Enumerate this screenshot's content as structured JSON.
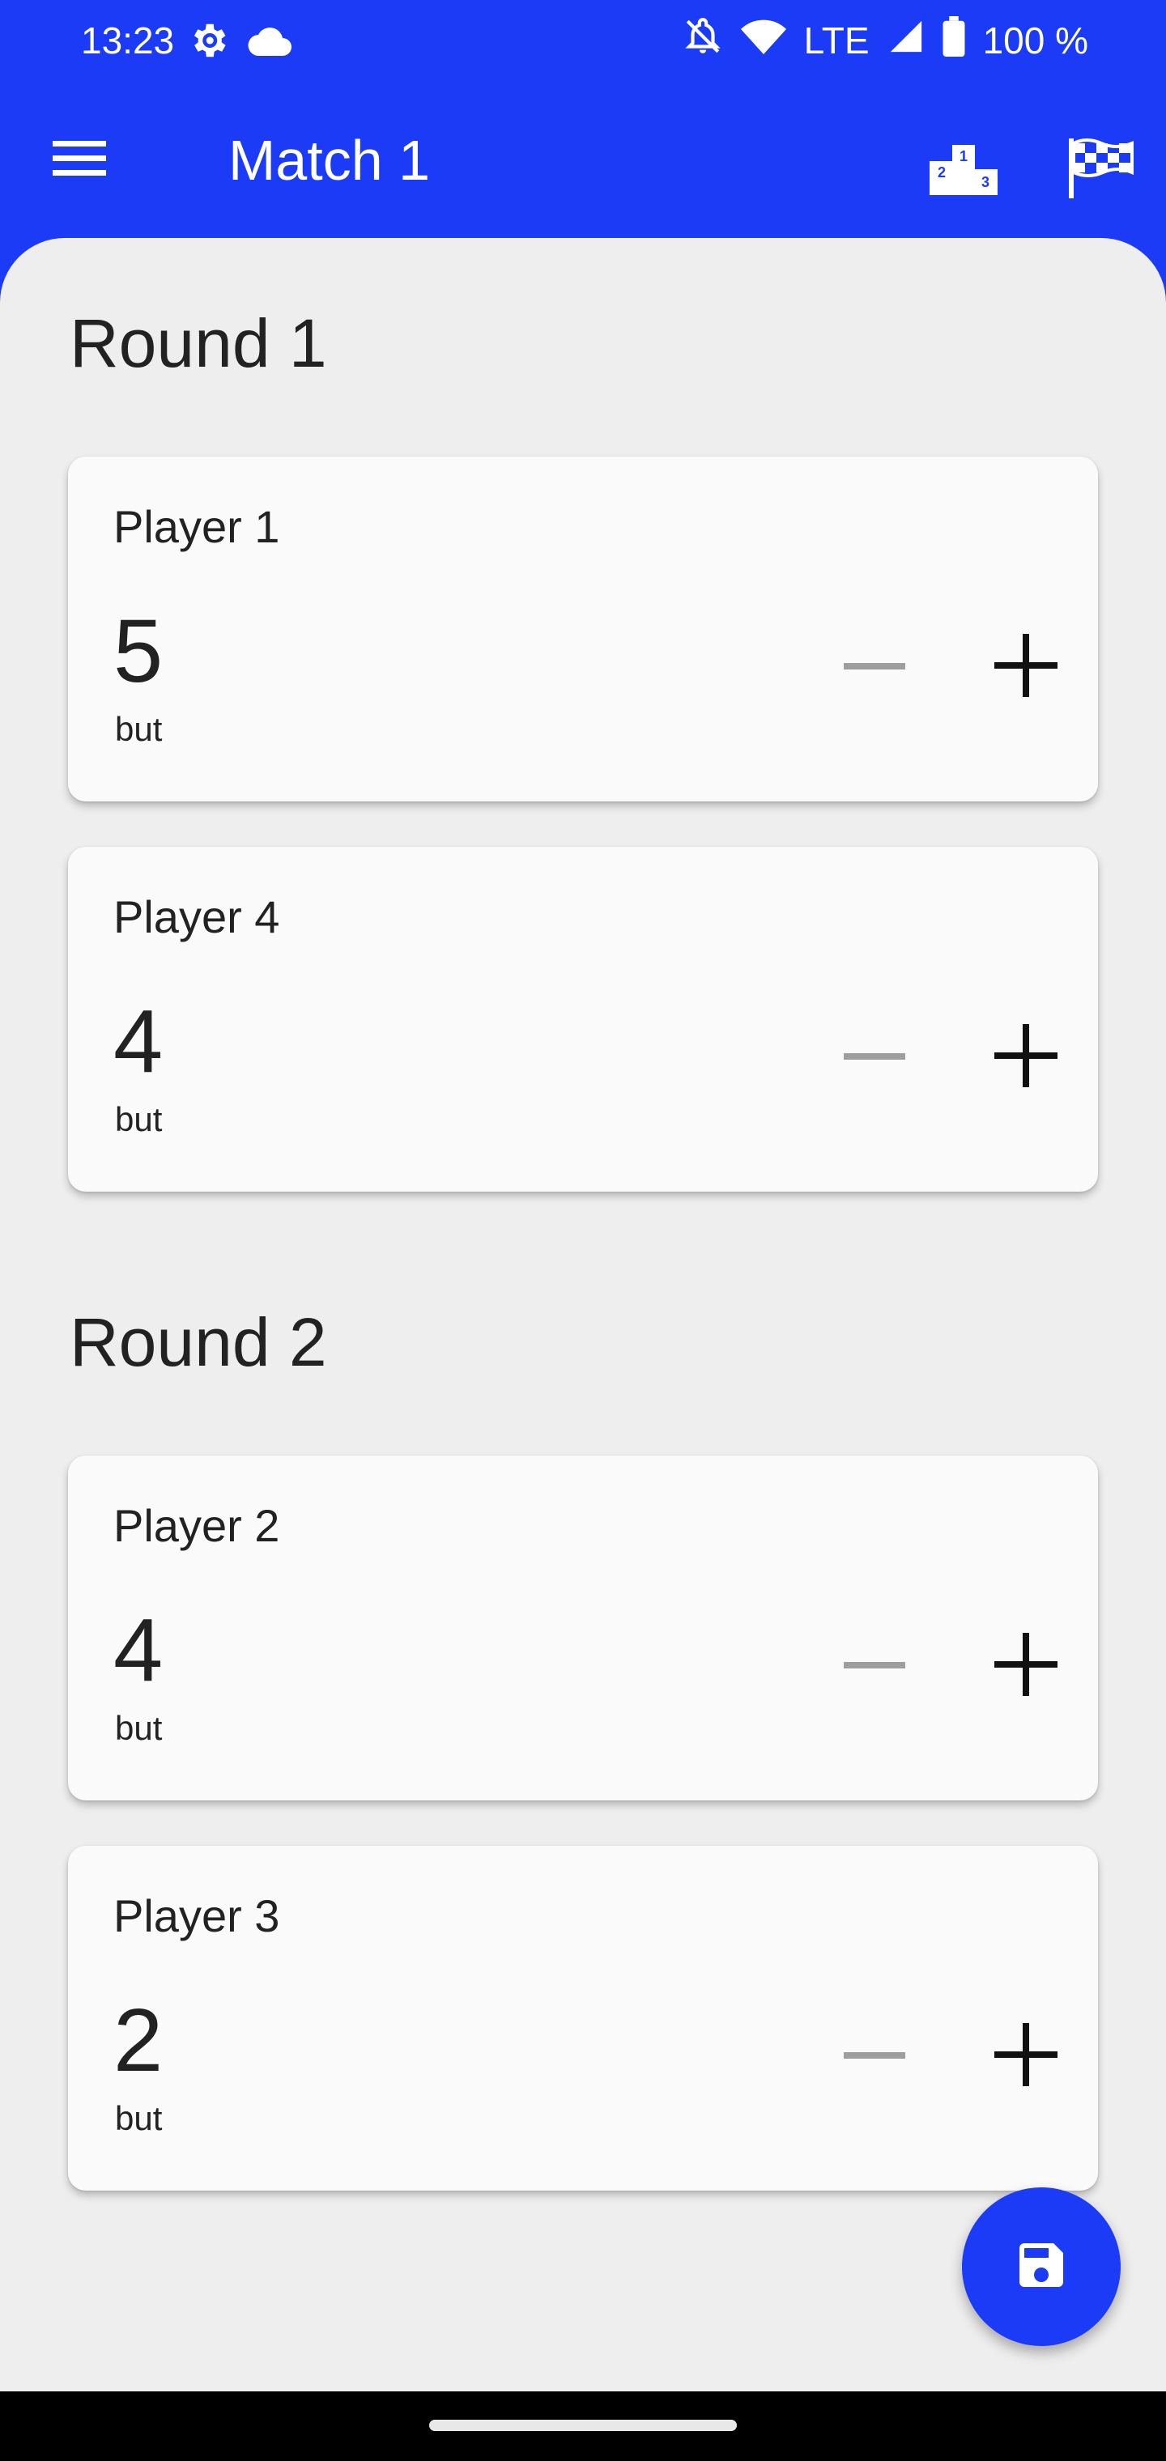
{
  "status_bar": {
    "time": "13:23",
    "network": "LTE",
    "battery": "100 %",
    "icons": [
      "settings-gear-icon",
      "cloud-icon",
      "notifications-off-icon",
      "wifi-icon",
      "signal-icon",
      "battery-icon"
    ]
  },
  "app_bar": {
    "title": "Match 1",
    "menu_icon": "menu-icon",
    "leaderboard_icon": "podium-icon",
    "leaderboard_labels": [
      "1",
      "2",
      "3"
    ],
    "finish_icon": "checkered-flag-icon"
  },
  "rounds": [
    {
      "title": "Round 1",
      "players": [
        {
          "name": "Player 1",
          "score": "5",
          "unit": "but"
        },
        {
          "name": "Player 4",
          "score": "4",
          "unit": "but"
        }
      ]
    },
    {
      "title": "Round 2",
      "players": [
        {
          "name": "Player 2",
          "score": "4",
          "unit": "but"
        },
        {
          "name": "Player 3",
          "score": "2",
          "unit": "but"
        }
      ]
    }
  ],
  "fab": {
    "icon": "save-icon"
  },
  "colors": {
    "primary": "#1b3bf7",
    "background": "#eeeeee",
    "card": "#fafafa",
    "minus_disabled": "#9e9e9e",
    "text": "#222222"
  }
}
